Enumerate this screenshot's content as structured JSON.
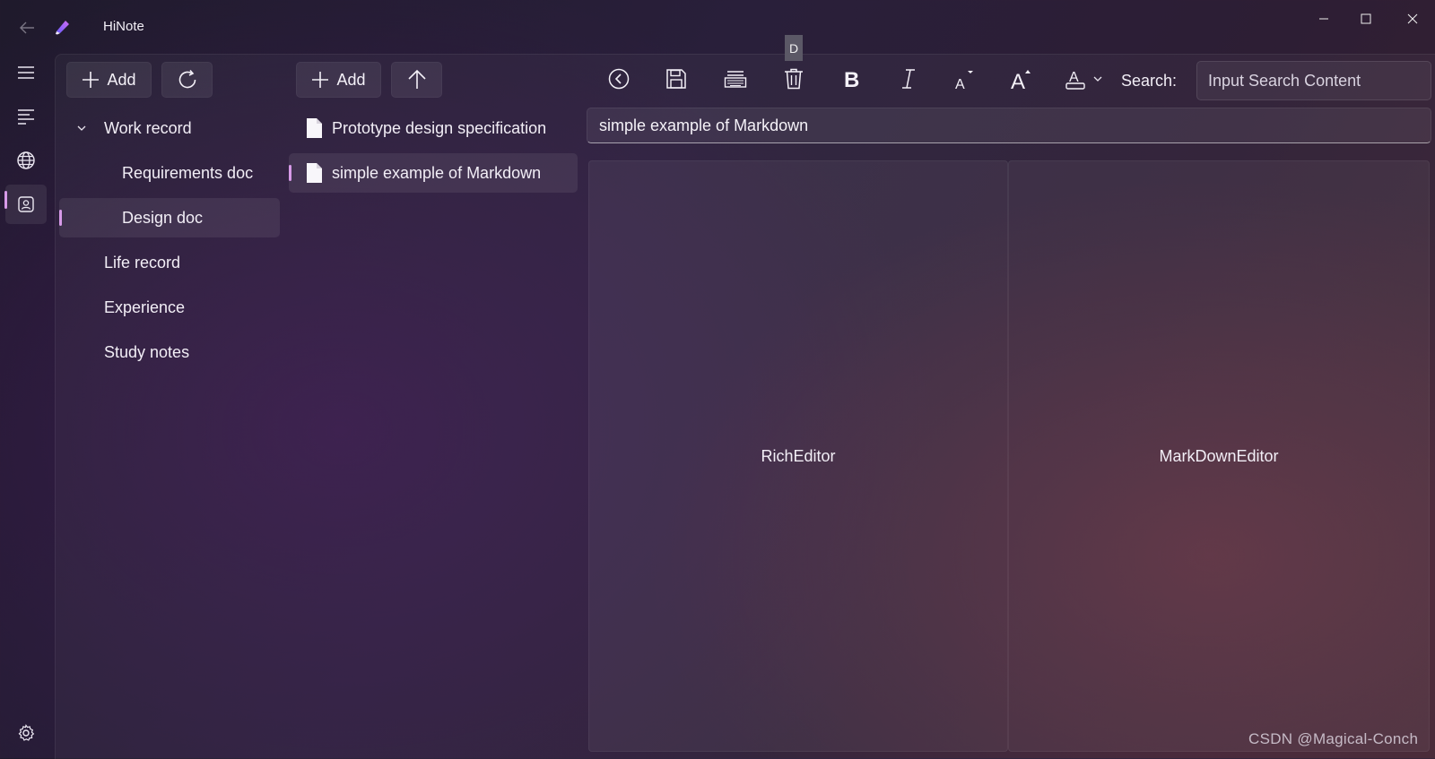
{
  "app": {
    "title": "HiNote"
  },
  "tooltip": "D",
  "category_toolbar": {
    "add_label": "Add"
  },
  "note_toolbar": {
    "add_label": "Add"
  },
  "categories": [
    {
      "label": "Work record",
      "expanded": true
    },
    {
      "label": "Requirements doc"
    },
    {
      "label": "Design doc",
      "selected": true
    },
    {
      "label": "Life record"
    },
    {
      "label": "Experience"
    },
    {
      "label": "Study notes"
    }
  ],
  "notes": [
    {
      "label": "Prototype design specification"
    },
    {
      "label": "simple example of Markdown",
      "selected": true
    }
  ],
  "editor_toolbar": {
    "icons": [
      "back-circle-icon",
      "save-icon",
      "keyboard-icon",
      "delete-icon",
      "bold-icon",
      "italic-icon",
      "font-size-decrease-icon",
      "font-size-increase-icon",
      "font-color-icon"
    ],
    "search_label": "Search:",
    "search_placeholder": "Input Search Content"
  },
  "note_title": "simple example of Markdown",
  "panes": {
    "left": "RichEditor",
    "right": "MarkDownEditor"
  },
  "watermark": "CSDN @Magical-Conch",
  "colors": {
    "accent": "#d79ae8"
  }
}
